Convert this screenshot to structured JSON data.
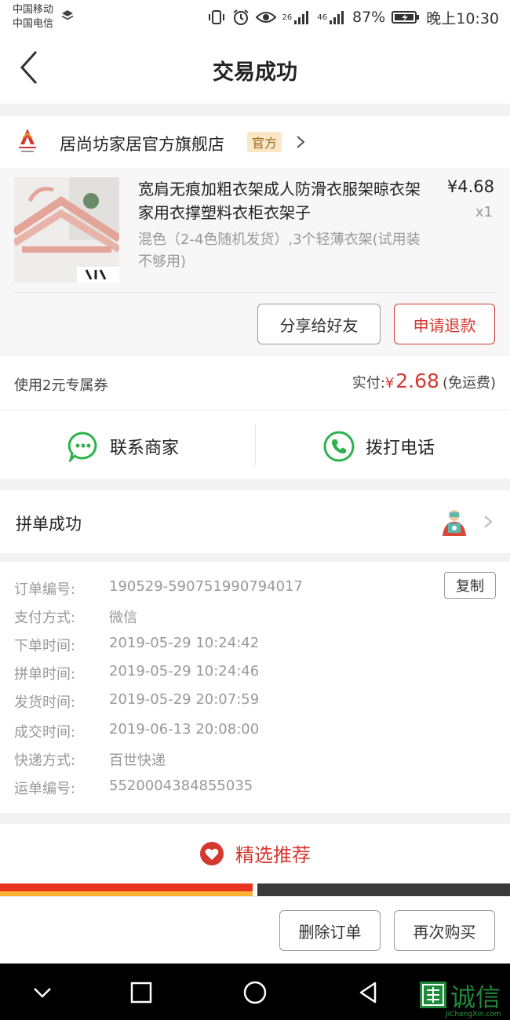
{
  "status_bar": {
    "carrier_1": "中国移动",
    "carrier_2": "中国电信",
    "net_1": "26",
    "net_2": "46",
    "battery": "87%",
    "time": "晚上10:30"
  },
  "header": {
    "title": "交易成功"
  },
  "shop": {
    "name": "居尚坊家居官方旗舰店",
    "badge": "官方"
  },
  "product": {
    "title": "宽肩无痕加粗衣架成人防滑衣服架晾衣架家用衣撑塑料衣柜衣架子",
    "price": "¥4.68",
    "quantity": "x1",
    "spec": "混色（2-4色随机发货）,3个轻薄衣架(试用装 不够用)"
  },
  "actions": {
    "share_label": "分享给好友",
    "refund_label": "申请退款"
  },
  "payment": {
    "coupon_text": "使用2元专属券",
    "paid_label": "实付:",
    "currency": "¥",
    "amount": "2.68",
    "shipping_note": "(免运费)"
  },
  "contact": {
    "chat_label": "联系商家",
    "call_label": "拨打电话"
  },
  "group": {
    "title": "拼单成功"
  },
  "order_details": {
    "copy_label": "复制",
    "rows": [
      {
        "label": "订单编号:",
        "value": "190529-590751990794017"
      },
      {
        "label": "支付方式:",
        "value": "微信"
      },
      {
        "label": "下单时间:",
        "value": "2019-05-29 10:24:42"
      },
      {
        "label": "拼单时间:",
        "value": "2019-05-29 10:24:46"
      },
      {
        "label": "发货时间:",
        "value": "2019-05-29 20:07:59"
      },
      {
        "label": "成交时间:",
        "value": "2019-06-13 20:08:00"
      },
      {
        "label": "快递方式:",
        "value": "百世快递"
      },
      {
        "label": "运单编号:",
        "value": "5520004384855035"
      }
    ]
  },
  "recommend": {
    "title": "精选推荐"
  },
  "bottom": {
    "delete_label": "删除订单",
    "rebuy_label": "再次购买"
  },
  "watermark": {
    "cn": "诚信",
    "en": "JiChengXin.com"
  },
  "colors": {
    "accent_red": "#d4382f",
    "wechat_green": "#2fb24c",
    "badge_bg": "#fbe6c6"
  }
}
